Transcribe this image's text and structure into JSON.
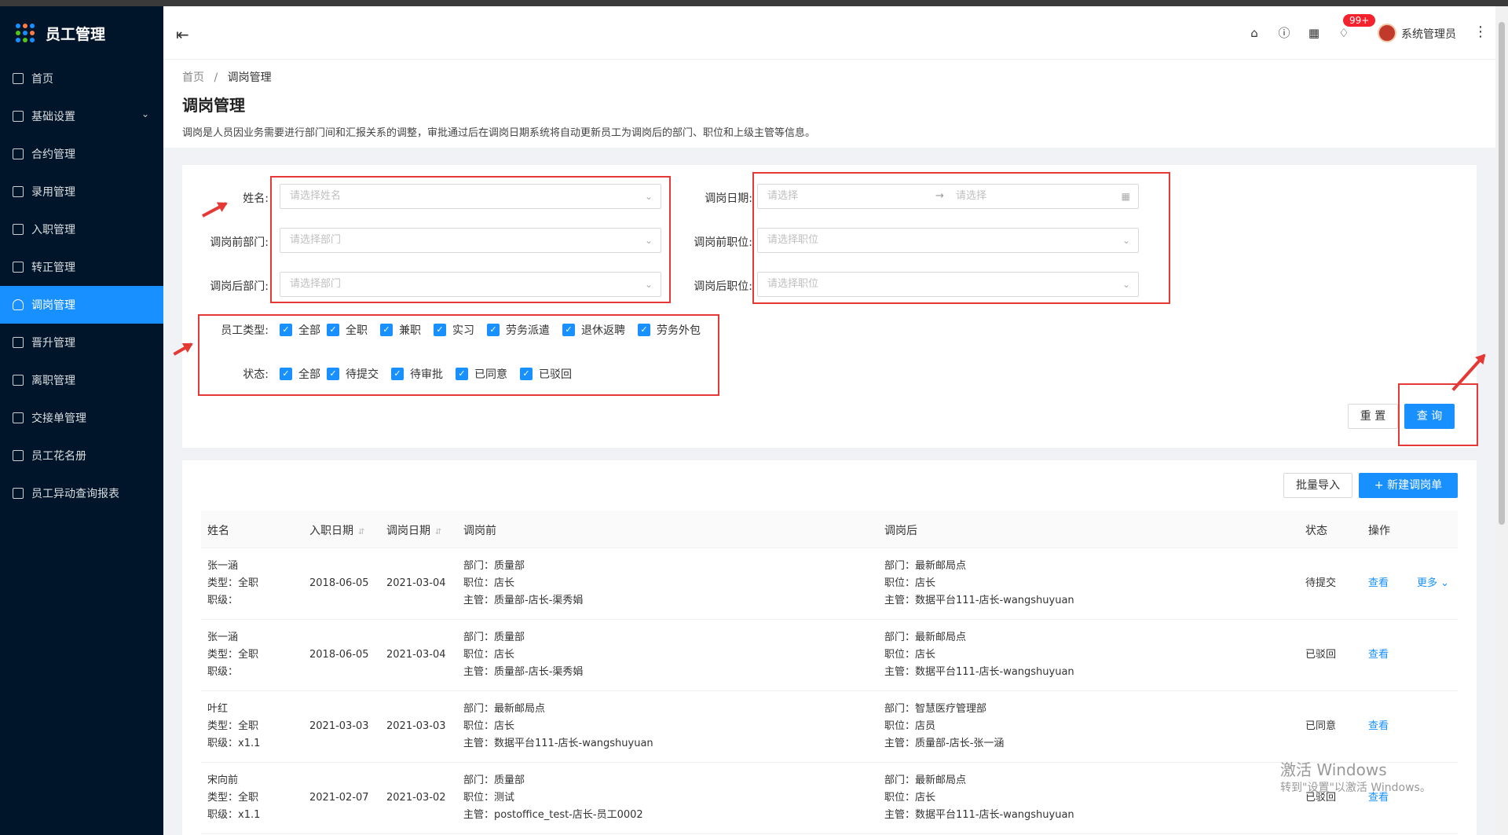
{
  "app": {
    "title": "员工管理"
  },
  "sidebar": {
    "items": [
      {
        "label": "首页",
        "icon": "home-icon"
      },
      {
        "label": "基础设置",
        "icon": "mail-icon",
        "expandable": true
      },
      {
        "label": "合约管理",
        "icon": "calendar-icon"
      },
      {
        "label": "录用管理",
        "icon": "form-icon"
      },
      {
        "label": "入职管理",
        "icon": "book-icon"
      },
      {
        "label": "转正管理",
        "icon": "grid-icon"
      },
      {
        "label": "调岗管理",
        "icon": "user-icon",
        "active": true
      },
      {
        "label": "晋升管理",
        "icon": "doc-icon"
      },
      {
        "label": "离职管理",
        "icon": "user-leave-icon"
      },
      {
        "label": "交接单管理",
        "icon": "copy-icon"
      },
      {
        "label": "员工花名册",
        "icon": "roster-icon"
      },
      {
        "label": "员工异动查询报表",
        "icon": "report-icon"
      }
    ]
  },
  "header": {
    "badge": "99+",
    "username": "系统管理员"
  },
  "breadcrumb": {
    "home": "首页",
    "sep": "/",
    "current": "调岗管理"
  },
  "page": {
    "title": "调岗管理",
    "desc": "调岗是人员因业务需要进行部门间和汇报关系的调整，审批通过后在调岗日期系统将自动更新员工为调岗后的部门、职位和上级主管等信息。"
  },
  "filter": {
    "name_label": "姓名:",
    "name_placeholder": "请选择姓名",
    "before_dept_label": "调岗前部门:",
    "before_dept_placeholder": "请选择部门",
    "after_dept_label": "调岗后部门:",
    "after_dept_placeholder": "请选择部门",
    "date_label": "调岗日期:",
    "date_start": "请选择",
    "date_end": "请选择",
    "before_pos_label": "调岗前职位:",
    "before_pos_placeholder": "请选择职位",
    "after_pos_label": "调岗后职位:",
    "after_pos_placeholder": "请选择职位",
    "emp_type_label": "员工类型:",
    "emp_types": [
      "全部",
      "全职",
      "兼职",
      "实习",
      "劳务派遣",
      "退休返聘",
      "劳务外包"
    ],
    "status_label": "状态:",
    "statuses": [
      "全部",
      "待提交",
      "待审批",
      "已同意",
      "已驳回"
    ],
    "reset": "重 置",
    "query": "查 询"
  },
  "table": {
    "import": "批量导入",
    "new": "新建调岗单",
    "headers": {
      "name": "姓名",
      "hire_date": "入职日期",
      "transfer_date": "调岗日期",
      "before": "调岗前",
      "after": "调岗后",
      "status": "状态",
      "action": "操作"
    },
    "rows": [
      {
        "name": "张一涵",
        "type": "类型：全职",
        "level": "职级：",
        "hire": "2018-06-05",
        "transfer": "2021-03-04",
        "b_dept": "部门：质量部",
        "b_pos": "职位：店长",
        "b_mgr": "主管：质量部-店长-渠秀娟",
        "a_dept": "部门：最新邮局点",
        "a_pos": "职位：店长",
        "a_mgr": "主管：数据平台111-店长-wangshuyuan",
        "status": "待提交",
        "view": "查看",
        "more": "更多"
      },
      {
        "name": "张一涵",
        "type": "类型：全职",
        "level": "职级：",
        "hire": "2018-06-05",
        "transfer": "2021-03-04",
        "b_dept": "部门：质量部",
        "b_pos": "职位：店长",
        "b_mgr": "主管：质量部-店长-渠秀娟",
        "a_dept": "部门：最新邮局点",
        "a_pos": "职位：店长",
        "a_mgr": "主管：数据平台111-店长-wangshuyuan",
        "status": "已驳回",
        "view": "查看"
      },
      {
        "name": "叶红",
        "type": "类型：全职",
        "level": "职级：x1.1",
        "hire": "2021-03-03",
        "transfer": "2021-03-03",
        "b_dept": "部门：最新邮局点",
        "b_pos": "职位：店长",
        "b_mgr": "主管：数据平台111-店长-wangshuyuan",
        "a_dept": "部门：智慧医疗管理部",
        "a_pos": "职位：店员",
        "a_mgr": "主管：质量部-店长-张一涵",
        "status": "已同意",
        "view": "查看"
      },
      {
        "name": "宋向前",
        "type": "类型：全职",
        "level": "职级：x1.1",
        "hire": "2021-02-07",
        "transfer": "2021-03-02",
        "b_dept": "部门：质量部",
        "b_pos": "职位：测试",
        "b_mgr": "主管：postoffice_test-店长-员工0002",
        "a_dept": "部门：最新邮局点",
        "a_pos": "职位：店长",
        "a_mgr": "主管：数据平台111-店长-wangshuyuan",
        "status": "已驳回",
        "view": "查看"
      }
    ]
  },
  "watermark": {
    "line1": "激活 Windows",
    "line2": "转到\"设置\"以激活 Windows。"
  }
}
